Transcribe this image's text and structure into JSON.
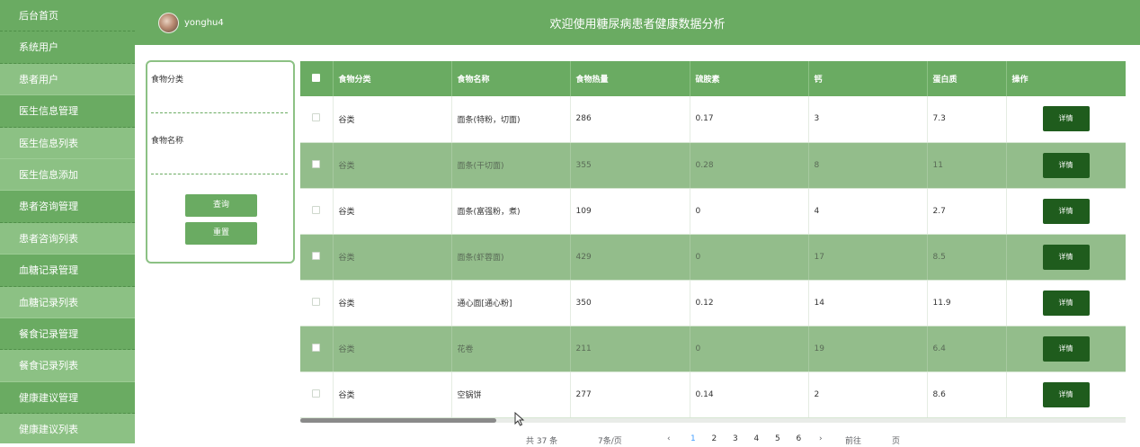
{
  "sidebar": {
    "items": [
      {
        "label": "后台首页",
        "child": false
      },
      {
        "label": "系统用户",
        "child": false
      },
      {
        "label": "患者用户",
        "child": true
      },
      {
        "label": "医生信息管理",
        "child": false
      },
      {
        "label": "医生信息列表",
        "child": true
      },
      {
        "label": "医生信息添加",
        "child": true
      },
      {
        "label": "患者咨询管理",
        "child": false
      },
      {
        "label": "患者咨询列表",
        "child": true
      },
      {
        "label": "血糖记录管理",
        "child": false
      },
      {
        "label": "血糖记录列表",
        "child": true
      },
      {
        "label": "餐食记录管理",
        "child": false
      },
      {
        "label": "餐食记录列表",
        "child": true
      },
      {
        "label": "健康建议管理",
        "child": false
      },
      {
        "label": "健康建议列表",
        "child": true
      }
    ]
  },
  "header": {
    "username": "yonghu4",
    "title": "欢迎使用糖尿病患者健康数据分析"
  },
  "search": {
    "category_label": "食物分类",
    "name_label": "食物名称",
    "category_value": "",
    "name_value": "",
    "query_button": "查询",
    "reset_button": "重置"
  },
  "table": {
    "columns": [
      "食物分类",
      "食物名称",
      "食物热量",
      "硫胺素",
      "钙",
      "蛋白质",
      "操作"
    ],
    "detail_label": "详情",
    "rows": [
      [
        "谷类",
        "面条(特粉，切面)",
        "286",
        "0.17",
        "3",
        "7.3"
      ],
      [
        "谷类",
        "面条(干切面)",
        "355",
        "0.28",
        "8",
        "11"
      ],
      [
        "谷类",
        "面条(富强粉，煮)",
        "109",
        "0",
        "4",
        "2.7"
      ],
      [
        "谷类",
        "面条(虾蓉面)",
        "429",
        "0",
        "17",
        "8.5"
      ],
      [
        "谷类",
        "通心面[通心粉]",
        "350",
        "0.12",
        "14",
        "11.9"
      ],
      [
        "谷类",
        "花卷",
        "211",
        "0",
        "19",
        "6.4"
      ],
      [
        "谷类",
        "空锅饼",
        "277",
        "0.14",
        "2",
        "8.6"
      ]
    ]
  },
  "pagination": {
    "total": "共 37 条",
    "page_size": "7条/页",
    "prev": "‹",
    "pages": [
      "1",
      "2",
      "3",
      "4",
      "5",
      "6"
    ],
    "current": "1",
    "next": "›",
    "goto": "前往",
    "page_unit": "页"
  },
  "colors": {
    "primary": "#6aab62",
    "alt_row": "#93bd8b",
    "detail_button": "#1f5c1d"
  }
}
